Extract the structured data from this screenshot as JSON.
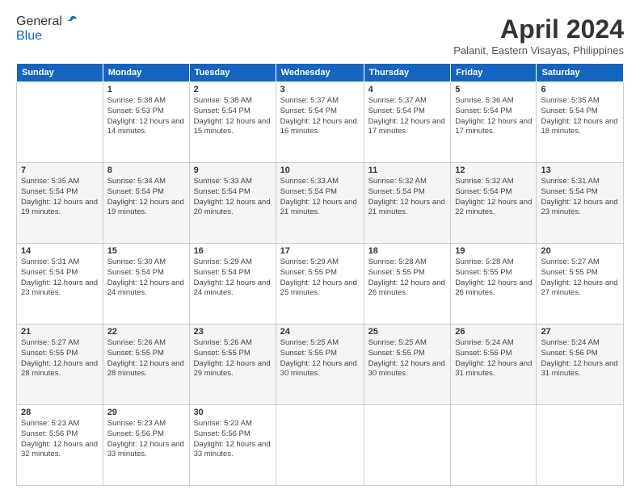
{
  "header": {
    "logo_line1": "General",
    "logo_line2": "Blue",
    "month": "April 2024",
    "location": "Palanit, Eastern Visayas, Philippines"
  },
  "weekdays": [
    "Sunday",
    "Monday",
    "Tuesday",
    "Wednesday",
    "Thursday",
    "Friday",
    "Saturday"
  ],
  "weeks": [
    [
      {
        "day": "",
        "sunrise": "",
        "sunset": "",
        "daylight": ""
      },
      {
        "day": "1",
        "sunrise": "5:38 AM",
        "sunset": "5:53 PM",
        "daylight": "12 hours and 14 minutes."
      },
      {
        "day": "2",
        "sunrise": "5:38 AM",
        "sunset": "5:54 PM",
        "daylight": "12 hours and 15 minutes."
      },
      {
        "day": "3",
        "sunrise": "5:37 AM",
        "sunset": "5:54 PM",
        "daylight": "12 hours and 16 minutes."
      },
      {
        "day": "4",
        "sunrise": "5:37 AM",
        "sunset": "5:54 PM",
        "daylight": "12 hours and 17 minutes."
      },
      {
        "day": "5",
        "sunrise": "5:36 AM",
        "sunset": "5:54 PM",
        "daylight": "12 hours and 17 minutes."
      },
      {
        "day": "6",
        "sunrise": "5:35 AM",
        "sunset": "5:54 PM",
        "daylight": "12 hours and 18 minutes."
      }
    ],
    [
      {
        "day": "7",
        "sunrise": "5:35 AM",
        "sunset": "5:54 PM",
        "daylight": "12 hours and 19 minutes."
      },
      {
        "day": "8",
        "sunrise": "5:34 AM",
        "sunset": "5:54 PM",
        "daylight": "12 hours and 19 minutes."
      },
      {
        "day": "9",
        "sunrise": "5:33 AM",
        "sunset": "5:54 PM",
        "daylight": "12 hours and 20 minutes."
      },
      {
        "day": "10",
        "sunrise": "5:33 AM",
        "sunset": "5:54 PM",
        "daylight": "12 hours and 21 minutes."
      },
      {
        "day": "11",
        "sunrise": "5:32 AM",
        "sunset": "5:54 PM",
        "daylight": "12 hours and 21 minutes."
      },
      {
        "day": "12",
        "sunrise": "5:32 AM",
        "sunset": "5:54 PM",
        "daylight": "12 hours and 22 minutes."
      },
      {
        "day": "13",
        "sunrise": "5:31 AM",
        "sunset": "5:54 PM",
        "daylight": "12 hours and 23 minutes."
      }
    ],
    [
      {
        "day": "14",
        "sunrise": "5:31 AM",
        "sunset": "5:54 PM",
        "daylight": "12 hours and 23 minutes."
      },
      {
        "day": "15",
        "sunrise": "5:30 AM",
        "sunset": "5:54 PM",
        "daylight": "12 hours and 24 minutes."
      },
      {
        "day": "16",
        "sunrise": "5:29 AM",
        "sunset": "5:54 PM",
        "daylight": "12 hours and 24 minutes."
      },
      {
        "day": "17",
        "sunrise": "5:29 AM",
        "sunset": "5:55 PM",
        "daylight": "12 hours and 25 minutes."
      },
      {
        "day": "18",
        "sunrise": "5:28 AM",
        "sunset": "5:55 PM",
        "daylight": "12 hours and 26 minutes."
      },
      {
        "day": "19",
        "sunrise": "5:28 AM",
        "sunset": "5:55 PM",
        "daylight": "12 hours and 26 minutes."
      },
      {
        "day": "20",
        "sunrise": "5:27 AM",
        "sunset": "5:55 PM",
        "daylight": "12 hours and 27 minutes."
      }
    ],
    [
      {
        "day": "21",
        "sunrise": "5:27 AM",
        "sunset": "5:55 PM",
        "daylight": "12 hours and 28 minutes."
      },
      {
        "day": "22",
        "sunrise": "5:26 AM",
        "sunset": "5:55 PM",
        "daylight": "12 hours and 28 minutes."
      },
      {
        "day": "23",
        "sunrise": "5:26 AM",
        "sunset": "5:55 PM",
        "daylight": "12 hours and 29 minutes."
      },
      {
        "day": "24",
        "sunrise": "5:25 AM",
        "sunset": "5:55 PM",
        "daylight": "12 hours and 30 minutes."
      },
      {
        "day": "25",
        "sunrise": "5:25 AM",
        "sunset": "5:55 PM",
        "daylight": "12 hours and 30 minutes."
      },
      {
        "day": "26",
        "sunrise": "5:24 AM",
        "sunset": "5:56 PM",
        "daylight": "12 hours and 31 minutes."
      },
      {
        "day": "27",
        "sunrise": "5:24 AM",
        "sunset": "5:56 PM",
        "daylight": "12 hours and 31 minutes."
      }
    ],
    [
      {
        "day": "28",
        "sunrise": "5:23 AM",
        "sunset": "5:56 PM",
        "daylight": "12 hours and 32 minutes."
      },
      {
        "day": "29",
        "sunrise": "5:23 AM",
        "sunset": "5:56 PM",
        "daylight": "12 hours and 33 minutes."
      },
      {
        "day": "30",
        "sunrise": "5:23 AM",
        "sunset": "5:56 PM",
        "daylight": "12 hours and 33 minutes."
      },
      {
        "day": "",
        "sunrise": "",
        "sunset": "",
        "daylight": ""
      },
      {
        "day": "",
        "sunrise": "",
        "sunset": "",
        "daylight": ""
      },
      {
        "day": "",
        "sunrise": "",
        "sunset": "",
        "daylight": ""
      },
      {
        "day": "",
        "sunrise": "",
        "sunset": "",
        "daylight": ""
      }
    ]
  ]
}
